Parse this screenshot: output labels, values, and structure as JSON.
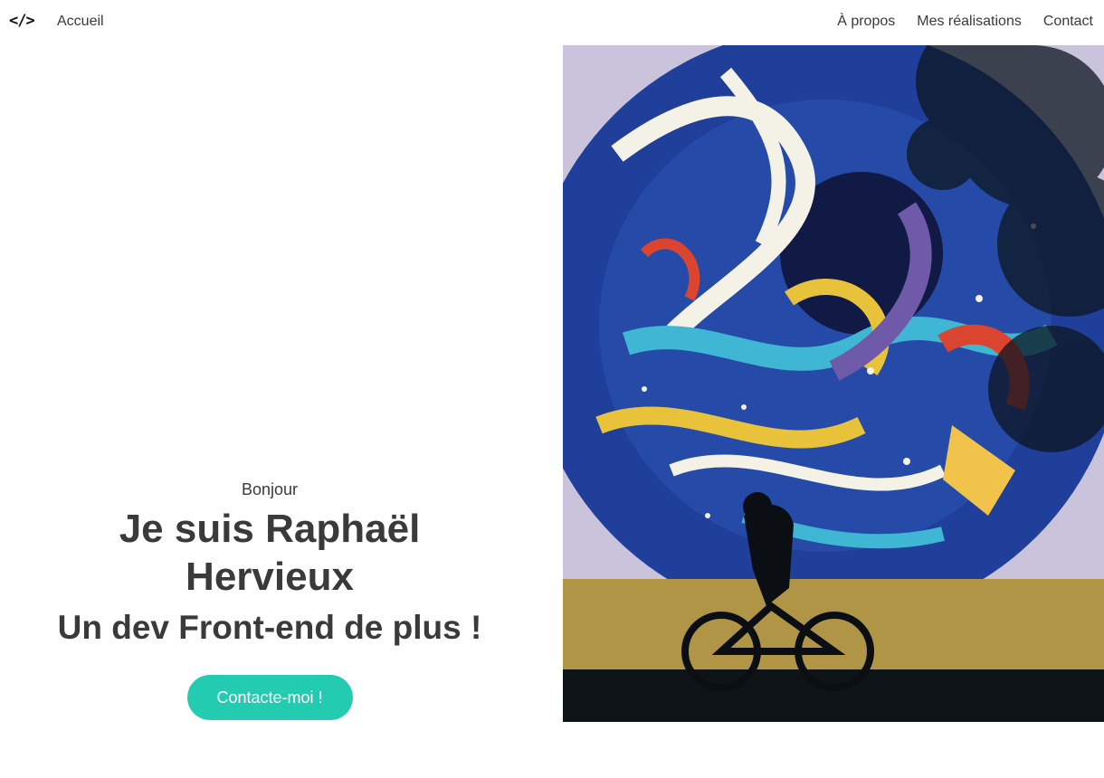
{
  "nav": {
    "logo": "</>",
    "home": "Accueil",
    "links": [
      "À propos",
      "Mes réalisations",
      "Contact"
    ]
  },
  "hero": {
    "greeting": "Bonjour",
    "name": "Je suis Raphaël Hervieux",
    "tagline": "Un dev Front-end de plus !",
    "cta_label": "Contacte-moi !"
  },
  "image": {
    "icon": "street-mural-photo"
  },
  "colors": {
    "accent": "#23ccb0",
    "text": "#3a3a3a"
  }
}
